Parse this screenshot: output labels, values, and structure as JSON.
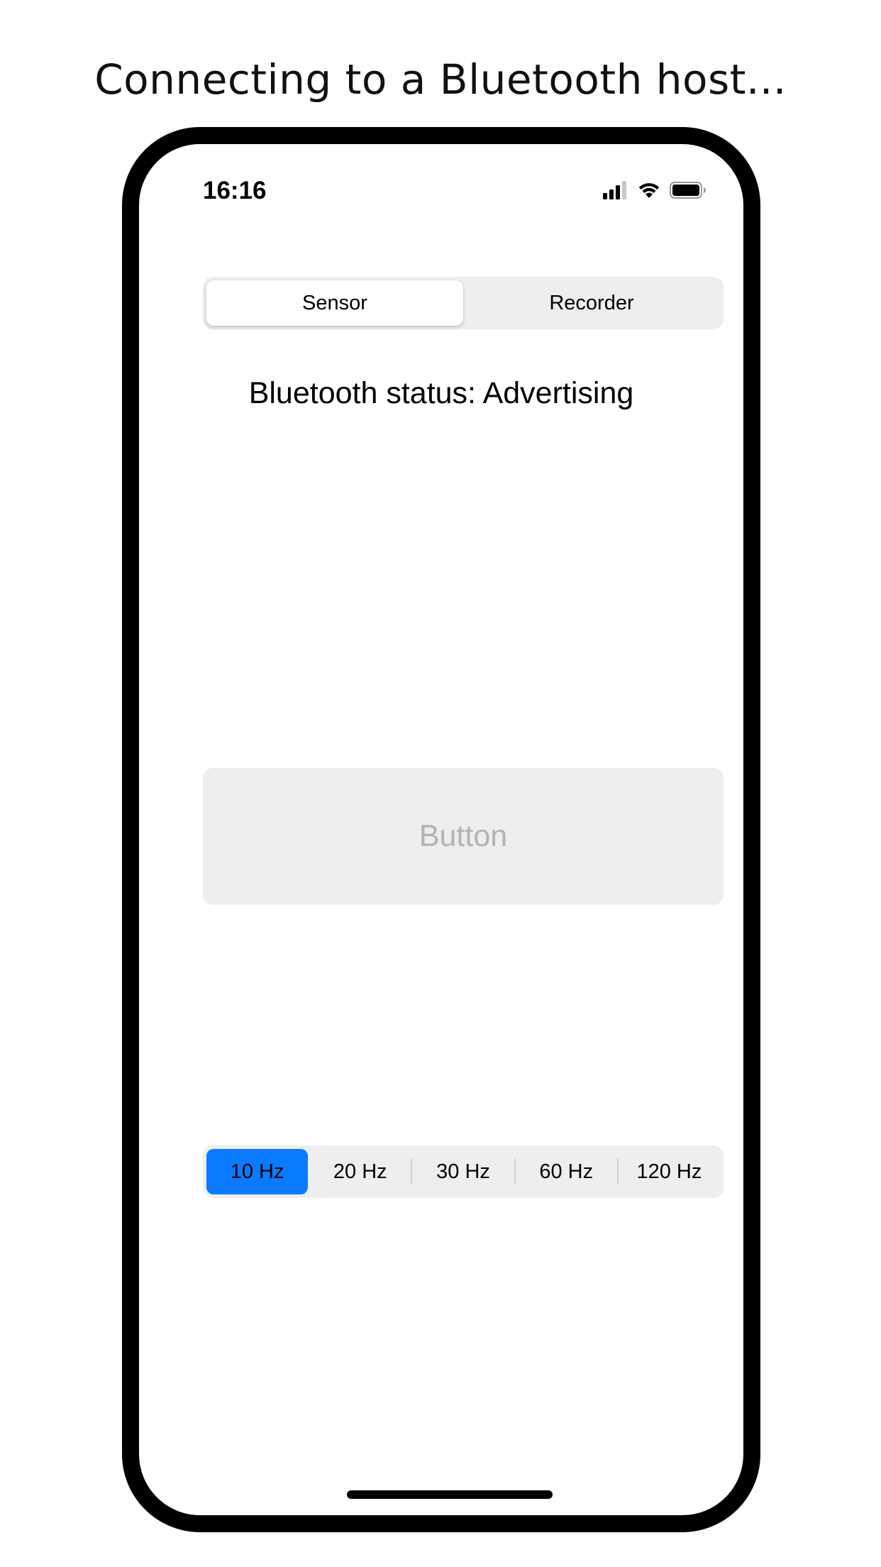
{
  "caption": "Connecting to a Bluetooth host...",
  "status_bar": {
    "time": "16:16",
    "icons": [
      "cellular-signal-icon",
      "wifi-icon",
      "battery-icon"
    ]
  },
  "mode_selector": {
    "options": [
      "Sensor",
      "Recorder"
    ],
    "selected": "Sensor"
  },
  "bluetooth_status": "Bluetooth status: Advertising",
  "main_button": {
    "label": "Button",
    "enabled": false
  },
  "frequency_selector": {
    "options": [
      "10 Hz",
      "20 Hz",
      "30 Hz",
      "60 Hz",
      "120 Hz"
    ],
    "selected": "10 Hz"
  },
  "colors": {
    "accent": "#0a7aff",
    "segment_background": "#eeeeef",
    "button_background": "#eeeeee",
    "button_disabled_text": "#b3b3b3",
    "frame": "#000000"
  }
}
